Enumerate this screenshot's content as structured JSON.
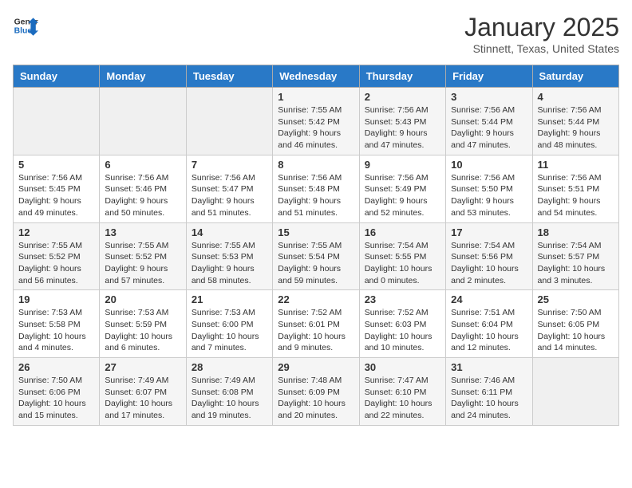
{
  "logo": {
    "line1": "General",
    "line2": "Blue"
  },
  "title": "January 2025",
  "subtitle": "Stinnett, Texas, United States",
  "days_of_week": [
    "Sunday",
    "Monday",
    "Tuesday",
    "Wednesday",
    "Thursday",
    "Friday",
    "Saturday"
  ],
  "weeks": [
    [
      {
        "day": "",
        "info": ""
      },
      {
        "day": "",
        "info": ""
      },
      {
        "day": "",
        "info": ""
      },
      {
        "day": "1",
        "info": "Sunrise: 7:55 AM\nSunset: 5:42 PM\nDaylight: 9 hours\nand 46 minutes."
      },
      {
        "day": "2",
        "info": "Sunrise: 7:56 AM\nSunset: 5:43 PM\nDaylight: 9 hours\nand 47 minutes."
      },
      {
        "day": "3",
        "info": "Sunrise: 7:56 AM\nSunset: 5:44 PM\nDaylight: 9 hours\nand 47 minutes."
      },
      {
        "day": "4",
        "info": "Sunrise: 7:56 AM\nSunset: 5:44 PM\nDaylight: 9 hours\nand 48 minutes."
      }
    ],
    [
      {
        "day": "5",
        "info": "Sunrise: 7:56 AM\nSunset: 5:45 PM\nDaylight: 9 hours\nand 49 minutes."
      },
      {
        "day": "6",
        "info": "Sunrise: 7:56 AM\nSunset: 5:46 PM\nDaylight: 9 hours\nand 50 minutes."
      },
      {
        "day": "7",
        "info": "Sunrise: 7:56 AM\nSunset: 5:47 PM\nDaylight: 9 hours\nand 51 minutes."
      },
      {
        "day": "8",
        "info": "Sunrise: 7:56 AM\nSunset: 5:48 PM\nDaylight: 9 hours\nand 51 minutes."
      },
      {
        "day": "9",
        "info": "Sunrise: 7:56 AM\nSunset: 5:49 PM\nDaylight: 9 hours\nand 52 minutes."
      },
      {
        "day": "10",
        "info": "Sunrise: 7:56 AM\nSunset: 5:50 PM\nDaylight: 9 hours\nand 53 minutes."
      },
      {
        "day": "11",
        "info": "Sunrise: 7:56 AM\nSunset: 5:51 PM\nDaylight: 9 hours\nand 54 minutes."
      }
    ],
    [
      {
        "day": "12",
        "info": "Sunrise: 7:55 AM\nSunset: 5:52 PM\nDaylight: 9 hours\nand 56 minutes."
      },
      {
        "day": "13",
        "info": "Sunrise: 7:55 AM\nSunset: 5:52 PM\nDaylight: 9 hours\nand 57 minutes."
      },
      {
        "day": "14",
        "info": "Sunrise: 7:55 AM\nSunset: 5:53 PM\nDaylight: 9 hours\nand 58 minutes."
      },
      {
        "day": "15",
        "info": "Sunrise: 7:55 AM\nSunset: 5:54 PM\nDaylight: 9 hours\nand 59 minutes."
      },
      {
        "day": "16",
        "info": "Sunrise: 7:54 AM\nSunset: 5:55 PM\nDaylight: 10 hours\nand 0 minutes."
      },
      {
        "day": "17",
        "info": "Sunrise: 7:54 AM\nSunset: 5:56 PM\nDaylight: 10 hours\nand 2 minutes."
      },
      {
        "day": "18",
        "info": "Sunrise: 7:54 AM\nSunset: 5:57 PM\nDaylight: 10 hours\nand 3 minutes."
      }
    ],
    [
      {
        "day": "19",
        "info": "Sunrise: 7:53 AM\nSunset: 5:58 PM\nDaylight: 10 hours\nand 4 minutes."
      },
      {
        "day": "20",
        "info": "Sunrise: 7:53 AM\nSunset: 5:59 PM\nDaylight: 10 hours\nand 6 minutes."
      },
      {
        "day": "21",
        "info": "Sunrise: 7:53 AM\nSunset: 6:00 PM\nDaylight: 10 hours\nand 7 minutes."
      },
      {
        "day": "22",
        "info": "Sunrise: 7:52 AM\nSunset: 6:01 PM\nDaylight: 10 hours\nand 9 minutes."
      },
      {
        "day": "23",
        "info": "Sunrise: 7:52 AM\nSunset: 6:03 PM\nDaylight: 10 hours\nand 10 minutes."
      },
      {
        "day": "24",
        "info": "Sunrise: 7:51 AM\nSunset: 6:04 PM\nDaylight: 10 hours\nand 12 minutes."
      },
      {
        "day": "25",
        "info": "Sunrise: 7:50 AM\nSunset: 6:05 PM\nDaylight: 10 hours\nand 14 minutes."
      }
    ],
    [
      {
        "day": "26",
        "info": "Sunrise: 7:50 AM\nSunset: 6:06 PM\nDaylight: 10 hours\nand 15 minutes."
      },
      {
        "day": "27",
        "info": "Sunrise: 7:49 AM\nSunset: 6:07 PM\nDaylight: 10 hours\nand 17 minutes."
      },
      {
        "day": "28",
        "info": "Sunrise: 7:49 AM\nSunset: 6:08 PM\nDaylight: 10 hours\nand 19 minutes."
      },
      {
        "day": "29",
        "info": "Sunrise: 7:48 AM\nSunset: 6:09 PM\nDaylight: 10 hours\nand 20 minutes."
      },
      {
        "day": "30",
        "info": "Sunrise: 7:47 AM\nSunset: 6:10 PM\nDaylight: 10 hours\nand 22 minutes."
      },
      {
        "day": "31",
        "info": "Sunrise: 7:46 AM\nSunset: 6:11 PM\nDaylight: 10 hours\nand 24 minutes."
      },
      {
        "day": "",
        "info": ""
      }
    ]
  ]
}
